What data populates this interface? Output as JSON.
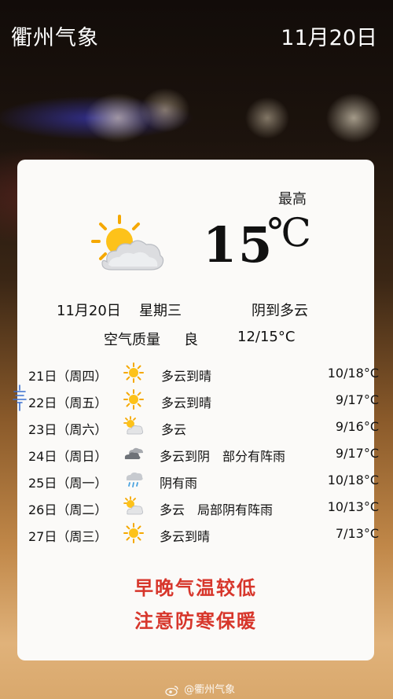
{
  "header": {
    "title": "衢州气象",
    "date": "11月20日"
  },
  "today": {
    "high_label": "最高",
    "high_temp": "15",
    "temp_unit": "℃",
    "icon": "partly-sunny-icon",
    "date": "11月20日",
    "weekday": "星期三",
    "condition": "阴到多云",
    "aqi_label": "空气质量",
    "aqi_value": "良",
    "range": "12/15°C"
  },
  "forecast": [
    {
      "day": "21日（周四）",
      "icon": "sun-icon",
      "condition": "多云到晴",
      "temp": "10/18°C"
    },
    {
      "day": "22日（周五）",
      "icon": "sun-icon",
      "condition": "多云到晴",
      "temp": "9/17°C"
    },
    {
      "day": "23日（周六）",
      "icon": "partly-cloudy-icon",
      "condition": "多云",
      "temp": "9/16°C"
    },
    {
      "day": "24日（周日）",
      "icon": "cloudy-icon",
      "condition": "多云到阴　部分有阵雨",
      "temp": "9/17°C"
    },
    {
      "day": "25日（周一）",
      "icon": "rain-icon",
      "condition": "阴有雨",
      "temp": "10/18°C"
    },
    {
      "day": "26日（周二）",
      "icon": "partly-cloudy-icon",
      "condition": "多云　局部阴有阵雨",
      "temp": "10/13°C"
    },
    {
      "day": "27日（周三）",
      "icon": "sun-icon",
      "condition": "多云到晴",
      "temp": "7/13°C"
    }
  ],
  "warning": {
    "line1": "早晚气温较低",
    "line2": "注意防寒保暖"
  },
  "watermark": "@衢州气象",
  "colors": {
    "warning": "#d7362b",
    "sun": "#f5b400",
    "card": "#fbfaf8"
  }
}
